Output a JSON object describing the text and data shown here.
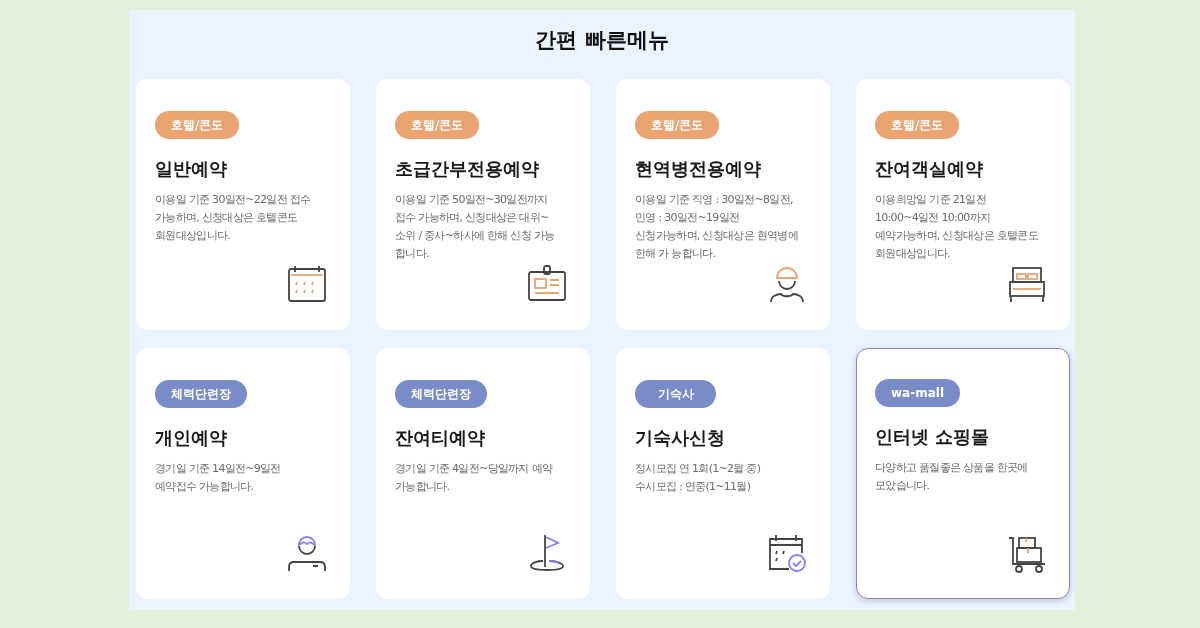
{
  "title": "간편 빠른메뉴",
  "cards": [
    {
      "tag": "호텔/콘도",
      "color": "#e9a472",
      "title": "일반예약",
      "description": "이용일 기준 30일전~22일전 접수\n가능하며, 신청대상은 호텔콘도\n회원대상입니다.",
      "kind": "calendar",
      "selected": false
    },
    {
      "tag": "호텔/콘도",
      "color": "#e9a472",
      "title": "초급간부전용예약",
      "description": "이용일 기준 50일전~30일전까지\n접수 가능하며, 신청대상은 대위~\n소위 / 중사~하사에 한해 신청 가능\n합니다.",
      "kind": "badge",
      "selected": false
    },
    {
      "tag": "호텔/콘도",
      "color": "#e9a472",
      "title": "현역병전용예약",
      "description": "이용일 기준 직영 : 30일전~8일전,\n민영 : 30일전~19일전\n신청가능하며, 신청대상은 현역병에\n한해 가 능합니다.",
      "kind": "soldier",
      "selected": false
    },
    {
      "tag": "호텔/콘도",
      "color": "#e9a472",
      "title": "잔여객실예약",
      "description": "이용희망일 기준 21일전\n10:00~4일전 10:00까지\n예약가능하며, 신청대상은 호텔콘도\n회원대상입니다.",
      "kind": "bed",
      "selected": false
    },
    {
      "tag": "체력단련장",
      "color": "#7a8cc8",
      "title": "개인예약",
      "description": "경기일 기준 14일전~9일전\n예약접수 가능합니다.",
      "kind": "person",
      "selected": false
    },
    {
      "tag": "체력단련장",
      "color": "#7a8cc8",
      "title": "잔여티예약",
      "description": "경기일 기준 4일전~당일까지 예약\n가능합니다.",
      "kind": "flag",
      "selected": false
    },
    {
      "tag": "기숙사",
      "color": "#7a8cc8",
      "title": "기숙사신청",
      "description": "정시모집 연 1회(1~2월 중)\n수시모집 : 연중(1~11월)",
      "kind": "calendar-check",
      "selected": false
    },
    {
      "tag": "wa-mall",
      "color": "#7a8cc8",
      "title": "인터넷 쇼핑몰",
      "description": "다양하고 품질좋은 상품을 한곳에\n모았습니다.",
      "kind": "cart",
      "selected": true
    }
  ]
}
